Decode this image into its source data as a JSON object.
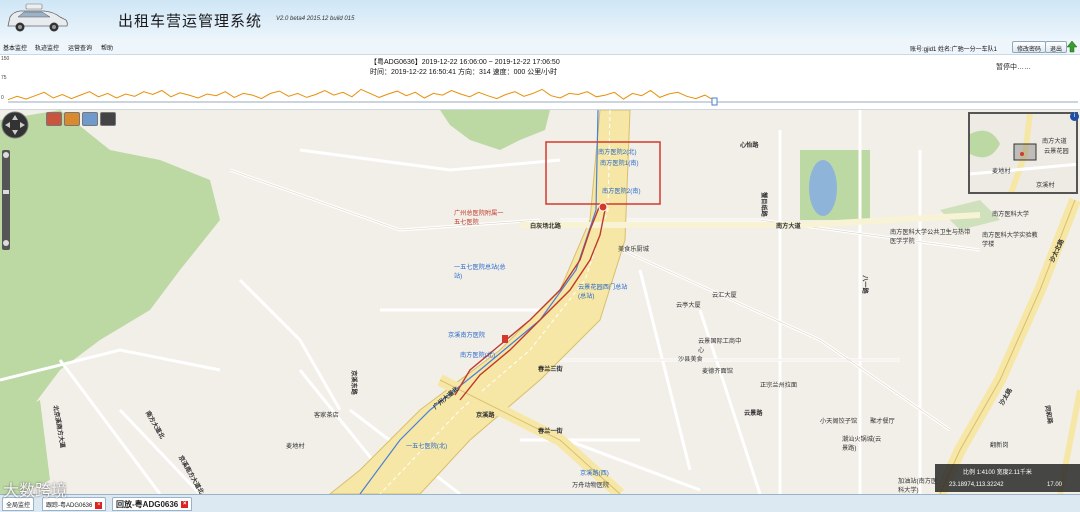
{
  "header": {
    "title": "出租车营运管理系统",
    "version": "V2.0 beta4 2015.12 build 015"
  },
  "menu": [
    {
      "label": "基本监控"
    },
    {
      "label": "轨迹监控"
    },
    {
      "label": "运营查询"
    },
    {
      "label": "帮助"
    }
  ],
  "user": {
    "info": "账号:gjid1 姓名:广驰一分一车队1",
    "change_password_label": "修改密码",
    "logout_label": "退出"
  },
  "track": {
    "line1": "【粤ADG0636】2019-12-22 16:06:00 ~ 2019-12-22 17:06:50",
    "line2": "时间：2019-12-22 16:50:41 方向：314 速度：000 公里/小时",
    "status": "暂停中……",
    "chart_ticks": [
      "150",
      "75",
      "0"
    ]
  },
  "chart_data": {
    "type": "line",
    "title": "",
    "xlabel": "",
    "ylabel": "",
    "ylim": [
      0,
      150
    ],
    "series": [
      {
        "color": "#e8900a",
        "values": [
          8,
          20,
          10,
          22,
          34,
          14,
          26,
          12,
          24,
          36,
          18,
          30,
          14,
          28,
          20,
          36,
          26,
          40,
          18,
          32,
          24,
          14,
          28,
          22,
          36,
          16,
          30,
          24,
          12,
          30,
          38,
          20,
          30,
          16,
          26,
          40,
          24,
          34,
          18,
          44,
          30,
          16,
          28,
          38,
          22,
          34,
          14,
          30,
          24,
          40,
          28,
          18,
          34,
          22,
          12,
          26,
          36,
          20,
          30,
          44,
          22,
          14,
          30,
          26,
          36,
          18,
          24,
          34,
          10,
          30,
          22,
          40,
          16,
          28,
          34,
          20,
          12,
          24,
          6
        ]
      }
    ]
  },
  "playback": {
    "buttons": [
      "fast-backward",
      "play",
      "step-forward",
      "fast-forward",
      "stop",
      "stop-end",
      "export"
    ]
  },
  "map": {
    "tools": [
      "home-icon",
      "ruler-icon",
      "search-icon",
      "back-icon"
    ],
    "labels": [
      {
        "text": "南方医院2(北)",
        "kind": "poi-blue"
      },
      {
        "text": "南方医院1(南)",
        "kind": "poi-blue"
      },
      {
        "text": "南方医院2(南)",
        "kind": "poi-blue"
      },
      {
        "text": "心怡路",
        "kind": "road"
      },
      {
        "text": "南方大道",
        "kind": "road"
      },
      {
        "text": "白灰场北路",
        "kind": "road"
      },
      {
        "text": "广州总医院附属一五七医院",
        "kind": "poi-red"
      },
      {
        "text": "一五七医院总站(总站)",
        "kind": "poi-blue"
      },
      {
        "text": "云景花园西门总站(总站)",
        "kind": "poi-blue"
      },
      {
        "text": "京溪南方医院",
        "kind": "poi-blue"
      },
      {
        "text": "南方医院(北)",
        "kind": "poi-blue"
      },
      {
        "text": "广州大道北",
        "kind": "road"
      },
      {
        "text": "京溪路",
        "kind": "road"
      },
      {
        "text": "京溪路(西)",
        "kind": "poi-blue"
      },
      {
        "text": "一五七医院(北)",
        "kind": "poi-blue"
      },
      {
        "text": "万舟动物医院",
        "kind": "plain"
      },
      {
        "text": "美食乐厨城",
        "kind": "plain"
      },
      {
        "text": "云汇大厦",
        "kind": "plain"
      },
      {
        "text": "云亭大厦",
        "kind": "plain"
      },
      {
        "text": "云景国际工商中心",
        "kind": "plain"
      },
      {
        "text": "沙县美食",
        "kind": "plain"
      },
      {
        "text": "麦德齐面馆",
        "kind": "plain"
      },
      {
        "text": "正宗兰州拉面",
        "kind": "plain"
      },
      {
        "text": "云景路",
        "kind": "road"
      },
      {
        "text": "小天阁饺子馆",
        "kind": "plain"
      },
      {
        "text": "聚才餐厅",
        "kind": "plain"
      },
      {
        "text": "潮汕火锅城(云景路)",
        "kind": "plain"
      },
      {
        "text": "南方医科大学公共卫生与热带医学学院",
        "kind": "plain"
      },
      {
        "text": "南方医科大学实验教学楼",
        "kind": "plain"
      },
      {
        "text": "南方医科大学",
        "kind": "plain"
      },
      {
        "text": "沙太北路",
        "kind": "road"
      },
      {
        "text": "沙太路",
        "kind": "road"
      },
      {
        "text": "春兰一街",
        "kind": "road"
      },
      {
        "text": "春兰三街",
        "kind": "road"
      },
      {
        "text": "客家茶店",
        "kind": "plain"
      },
      {
        "text": "麦地村",
        "kind": "plain"
      },
      {
        "text": "京溪东路",
        "kind": "road"
      },
      {
        "text": "南方大道北",
        "kind": "road"
      },
      {
        "text": "京溪南方大道北",
        "kind": "road"
      },
      {
        "text": "北京溪南方大道",
        "kind": "road"
      },
      {
        "text": "翻新岗",
        "kind": "plain"
      },
      {
        "text": "加油站(南方医科大学)",
        "kind": "plain"
      },
      {
        "text": "同和路",
        "kind": "road"
      },
      {
        "text": "八一路",
        "kind": "road"
      },
      {
        "text": "蟹目纸路",
        "kind": "road"
      }
    ],
    "minimap": {
      "labels": [
        "南方大道",
        "云景花园",
        "麦地村",
        "京溪村"
      ]
    },
    "scale": {
      "text": "比例 1:4100 宽度2.11千米",
      "coords": "23.18974,113.32242",
      "zoom": "17.00"
    }
  },
  "tabs": [
    {
      "label": "全局监控"
    },
    {
      "label": "跟踪-粤ADG0636"
    },
    {
      "label": "回放-粤ADG0636"
    }
  ],
  "watermark": "大数跨境"
}
